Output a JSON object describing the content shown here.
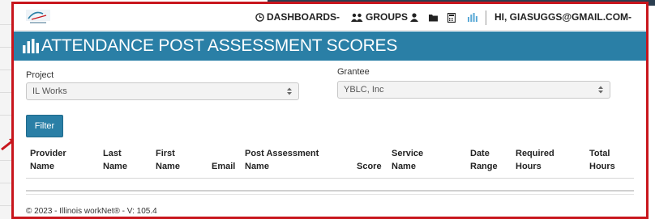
{
  "nav": {
    "dashboards": "DASHBOARDS",
    "groups": "GROUPS",
    "user_menu": "HI, GIASUGGS@GMAIL.COM"
  },
  "page": {
    "title": "ATTENDANCE POST ASSESSMENT SCORES"
  },
  "filters": {
    "project_label": "Project",
    "project_value": "IL Works",
    "grantee_label": "Grantee",
    "grantee_value": "YBLC, Inc",
    "filter_button": "Filter"
  },
  "table": {
    "columns": [
      [
        "Provider",
        "Name"
      ],
      [
        "Last",
        "Name"
      ],
      [
        "First",
        "Name"
      ],
      [
        "",
        "Email"
      ],
      [
        "Post Assessment",
        "Name"
      ],
      [
        "",
        "Score"
      ],
      [
        "Service",
        "Name"
      ],
      [
        "Date",
        "Range"
      ],
      [
        "Required",
        "Hours"
      ],
      [
        "Total",
        "Hours"
      ]
    ]
  },
  "footer": {
    "text": "© 2023 - Illinois workNet® - V: 105.4"
  },
  "colors": {
    "accent": "#2a7fa6",
    "callout_border": "#c8161d"
  },
  "icons": [
    "clock-icon",
    "groups-icon",
    "user-icon",
    "folder-icon",
    "calculator-icon",
    "bar-chart-icon",
    "logo"
  ]
}
